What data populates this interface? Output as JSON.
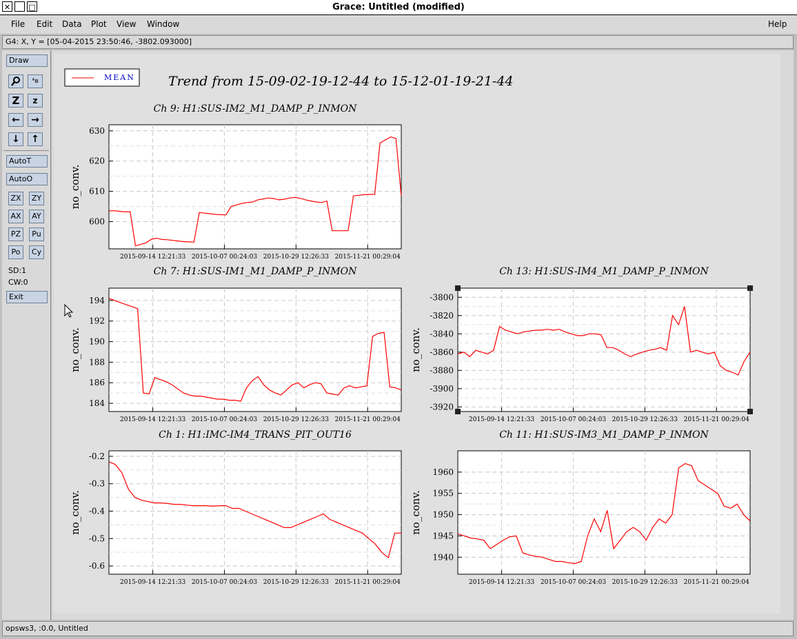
{
  "window": {
    "title": "Grace: Untitled (modified)"
  },
  "menu": {
    "file": "File",
    "edit": "Edit",
    "data": "Data",
    "plot": "Plot",
    "view": "View",
    "window": "Window",
    "help": "Help"
  },
  "locator": "G4: X, Y = [05-04-2015 23:50:46, -3802.093000]",
  "sidebar": {
    "draw": "Draw",
    "autot": "AutoT",
    "autoo": "AutoO",
    "zx": "ZX",
    "zy": "ZY",
    "ax": "AX",
    "ay": "AY",
    "pz": "PZ",
    "pu": "Pu",
    "po": "Po",
    "cy": "Cy",
    "sd": "SD:1",
    "cw": "CW:0",
    "exit": "Exit"
  },
  "status": "opsws3, :0.0, Untitled",
  "figure": {
    "title": "Trend from 15-09-02-19-12-44 to 15-12-01-19-21-44",
    "legend": "MEAN",
    "line_color": "#ff0000",
    "legend_text_color": "#0000cc"
  },
  "chart_data": [
    {
      "type": "line",
      "title": "Ch 9: H1:SUS-IM2_M1_DAMP_P_INMON",
      "ylabel": "no_conv.",
      "yticks": [
        "600",
        "610",
        "620",
        "630"
      ],
      "xticks": [
        "2015-09-14 12:21:33",
        "2015-10-07 00:24:03",
        "2015-10-29 12:26:33",
        "2015-11-21 00:29:04"
      ],
      "series": [
        {
          "name": "MEAN",
          "values": [
            603.5,
            603.6,
            603.4,
            603.2,
            603.3,
            592,
            592.5,
            593,
            594.2,
            594.5,
            594.1,
            594,
            593.8,
            593.6,
            593.4,
            593.3,
            593.2,
            603,
            602.8,
            602.6,
            602.4,
            602.3,
            602.2,
            605,
            605.5,
            606,
            606.3,
            606.5,
            607.2,
            607.5,
            607.8,
            607.6,
            607.2,
            607.4,
            607.8,
            608,
            607.7,
            607.2,
            606.8,
            606.5,
            606.3,
            606.8,
            597,
            597,
            597,
            597,
            608.5,
            608.7,
            608.9,
            609,
            609,
            626,
            627,
            628,
            627.5,
            608.6
          ]
        }
      ]
    },
    {
      "type": "line",
      "title": "Ch 7: H1:SUS-IM1_M1_DAMP_P_INMON",
      "ylabel": "no_conv.",
      "yticks": [
        "184",
        "186",
        "188",
        "190",
        "192",
        "194"
      ],
      "xticks": [
        "2015-09-14 12:21:33",
        "2015-10-07 00:24:03",
        "2015-10-29 12:26:33",
        "2015-11-21 00:29:04"
      ],
      "series": [
        {
          "name": "MEAN",
          "values": [
            194.2,
            194,
            193.8,
            193.6,
            193.4,
            193.2,
            185,
            184.9,
            186.5,
            186.3,
            186.1,
            185.8,
            185.4,
            185,
            184.8,
            184.7,
            184.7,
            184.6,
            184.5,
            184.4,
            184.4,
            184.3,
            184.3,
            184.2,
            185.5,
            186.2,
            186.6,
            185.8,
            185.3,
            185,
            184.8,
            185.3,
            185.8,
            186,
            185.5,
            185.8,
            186,
            185.9,
            185,
            184.9,
            184.8,
            185.5,
            185.7,
            185.5,
            185.6,
            185.7,
            190.5,
            190.8,
            190.9,
            185.6,
            185.5,
            185.3
          ]
        }
      ]
    },
    {
      "type": "line",
      "title": "Ch 13: H1:SUS-IM4_M1_DAMP_P_INMON",
      "ylabel": "no_conv.",
      "yticks": [
        "-3920",
        "-3900",
        "-3880",
        "-3860",
        "-3840",
        "-3820",
        "-3800"
      ],
      "xticks": [
        "2015-09-14 12:21:33",
        "2015-10-07 00:24:03",
        "2015-10-29 12:26:33",
        "2015-11-21 00:29:04"
      ],
      "series": [
        {
          "name": "MEAN",
          "values": [
            -3862,
            -3860,
            -3865,
            -3858,
            -3860,
            -3862,
            -3858,
            -3832,
            -3836,
            -3838,
            -3840,
            -3838,
            -3837,
            -3836,
            -3836,
            -3835,
            -3836,
            -3835,
            -3838,
            -3840,
            -3842,
            -3842,
            -3840,
            -3840,
            -3841,
            -3855,
            -3855,
            -3858,
            -3862,
            -3865,
            -3862,
            -3860,
            -3858,
            -3857,
            -3855,
            -3858,
            -3820,
            -3830,
            -3810,
            -3860,
            -3858,
            -3860,
            -3862,
            -3860,
            -3875,
            -3880,
            -3882,
            -3885,
            -3870,
            -3860
          ]
        }
      ]
    },
    {
      "type": "line",
      "title": "Ch 1: H1:IMC-IM4_TRANS_PIT_OUT16",
      "ylabel": "no_conv.",
      "yticks": [
        "-0.6",
        "-0.5",
        "-0.4",
        "-0.3",
        "-0.2"
      ],
      "xticks": [
        "2015-09-14 12:21:33",
        "2015-10-07 00:24:03",
        "2015-10-29 12:26:33",
        "2015-11-21 00:29:04"
      ],
      "series": [
        {
          "name": "MEAN",
          "values": [
            -0.22,
            -0.23,
            -0.26,
            -0.32,
            -0.35,
            -0.36,
            -0.365,
            -0.37,
            -0.37,
            -0.372,
            -0.375,
            -0.375,
            -0.378,
            -0.38,
            -0.38,
            -0.38,
            -0.382,
            -0.38,
            -0.38,
            -0.39,
            -0.39,
            -0.4,
            -0.41,
            -0.42,
            -0.43,
            -0.44,
            -0.45,
            -0.46,
            -0.46,
            -0.45,
            -0.44,
            -0.43,
            -0.42,
            -0.41,
            -0.43,
            -0.44,
            -0.45,
            -0.46,
            -0.47,
            -0.48,
            -0.5,
            -0.52,
            -0.55,
            -0.57,
            -0.48,
            -0.48
          ]
        }
      ]
    },
    {
      "type": "line",
      "title": "Ch 11: H1:SUS-IM3_M1_DAMP_P_INMON",
      "ylabel": "no_conv.",
      "yticks": [
        "1940",
        "1945",
        "1950",
        "1955",
        "1960"
      ],
      "xticks": [
        "2015-09-14 12:21:33",
        "2015-10-07 00:24:03",
        "2015-10-29 12:26:33",
        "2015-11-21 00:29:04"
      ],
      "series": [
        {
          "name": "MEAN",
          "values": [
            1945.5,
            1945,
            1944.5,
            1944.3,
            1944,
            1942,
            1943,
            1944,
            1944.8,
            1945,
            1941,
            1940.5,
            1940.2,
            1940,
            1939.5,
            1939,
            1939,
            1938.7,
            1938.5,
            1939,
            1945,
            1949,
            1946,
            1951,
            1942,
            1944,
            1946,
            1947,
            1946,
            1944,
            1947,
            1949,
            1948,
            1950,
            1961,
            1962,
            1961.5,
            1958,
            1957,
            1956,
            1955,
            1952,
            1951.5,
            1952.5,
            1950,
            1948.5
          ]
        }
      ]
    }
  ]
}
